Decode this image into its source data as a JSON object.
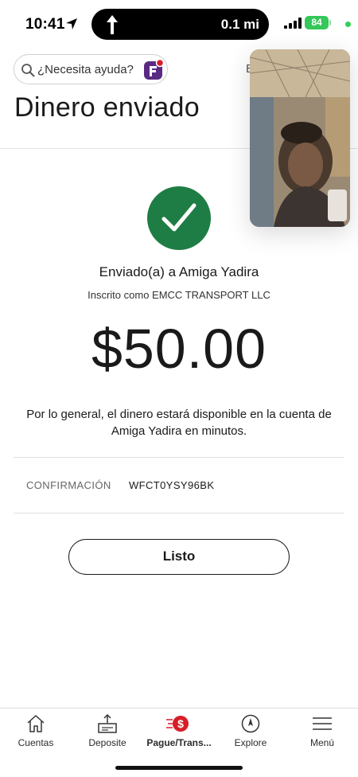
{
  "status_bar": {
    "time": "10:41",
    "island_distance": "0.1 mi",
    "battery": "84"
  },
  "search": {
    "placeholder": "¿Necesita ayuda?"
  },
  "header": {
    "partial_text": "E",
    "title": "Dinero enviado"
  },
  "confirmation": {
    "sent_to": "Enviado(a) a Amiga Yadira",
    "enrolled_as": "Inscrito como EMCC TRANSPORT LLC",
    "amount": "$50.00",
    "note": "Por lo general, el dinero estará disponible en la cuenta de Amiga Yadira en minutos.",
    "code_label": "CONFIRMACIÓN",
    "code_value": "WFCT0YSY96BK",
    "done_label": "Listo"
  },
  "tab_bar": {
    "items": [
      {
        "label": "Cuentas",
        "icon": "home-icon"
      },
      {
        "label": "Deposite",
        "icon": "deposit-icon"
      },
      {
        "label": "Pague/Trans...",
        "icon": "pay-transfer-icon",
        "active": true
      },
      {
        "label": "Explore",
        "icon": "compass-icon"
      },
      {
        "label": "Menú",
        "icon": "menu-icon"
      }
    ]
  },
  "colors": {
    "success_green": "#1e7d45",
    "brand_red": "#d71e28",
    "brand_purple": "#5a2a82"
  }
}
